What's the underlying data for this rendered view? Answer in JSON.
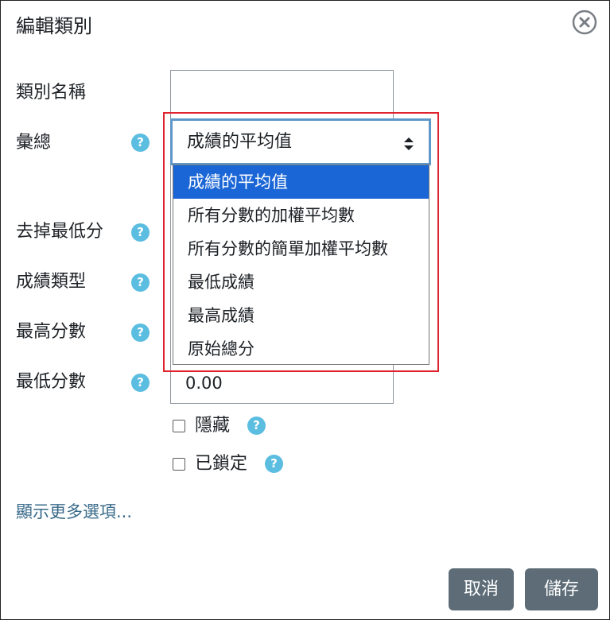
{
  "dialog": {
    "title": "編輯類別",
    "close_icon": "close-circle-icon"
  },
  "form": {
    "category_name_label": "類別名稱",
    "category_name_value": "",
    "aggregation_label": "彙總",
    "aggregation_selected": "成績的平均值",
    "aggregation_options": [
      "成績的平均值",
      "所有分數的加權平均數",
      "所有分數的簡單加權平均數",
      "最低成績",
      "最高成績",
      "原始總分"
    ],
    "drop_lowest_label": "去掉最低分",
    "grade_type_label": "成績類型",
    "max_grade_label": "最高分數",
    "min_grade_label": "最低分數",
    "min_grade_value": "0.00",
    "hidden_label": "隱藏",
    "locked_label": "已鎖定",
    "help_glyph": "?"
  },
  "show_more": "顯示更多選項...",
  "buttons": {
    "cancel": "取消",
    "save": "儲存"
  },
  "colors": {
    "selected_option_bg": "#1a66d6",
    "help_icon": "#5bbde0",
    "button_bg": "#5d6c77",
    "highlight_border": "#e0242f",
    "link": "#3a6b8a"
  }
}
